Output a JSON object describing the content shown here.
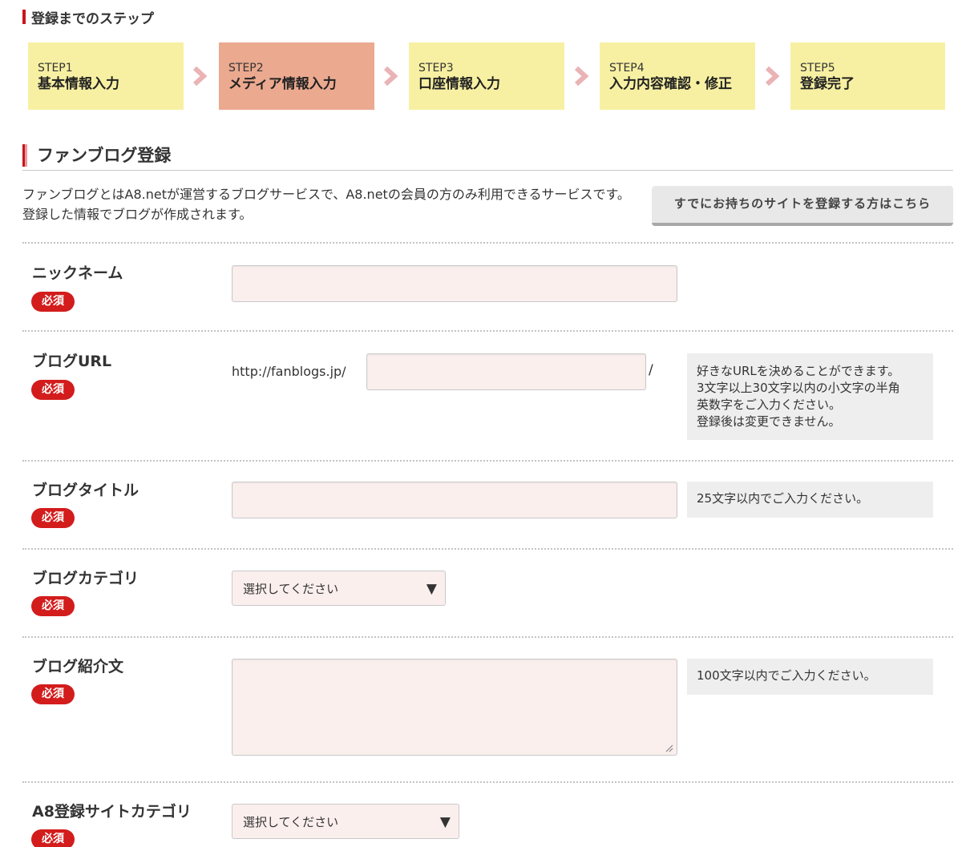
{
  "steps_heading": "登録までのステップ",
  "steps": [
    {
      "num": "STEP1",
      "name": "基本情報入力",
      "active": false
    },
    {
      "num": "STEP2",
      "name": "メディア情報入力",
      "active": true
    },
    {
      "num": "STEP3",
      "name": "口座情報入力",
      "active": false
    },
    {
      "num": "STEP4",
      "name": "入力内容確認・修正",
      "active": false
    },
    {
      "num": "STEP5",
      "name": "登録完了",
      "active": false
    }
  ],
  "section": {
    "title": "ファンブログ登録",
    "intro": "ファンブログとはA8.netが運営するブログサービスで、A8.netの会員の方のみ利用できるサービスです。登録した情報でブログが作成されます。",
    "existing_button": "すでにお持ちのサイトを登録する方はこちら"
  },
  "required_badge": "必須",
  "form": {
    "nickname": {
      "label": "ニックネーム",
      "value": ""
    },
    "blog_url": {
      "label": "ブログURL",
      "prefix": "http://fanblogs.jp/",
      "suffix": "/",
      "value": "",
      "note": [
        "好きなURLを決めることができます。",
        "3文字以上30文字以内の小文字の半角",
        "英数字をご入力ください。",
        "登録後は変更できません。"
      ]
    },
    "blog_title": {
      "label": "ブログタイトル",
      "value": "",
      "note": "25文字以内でご入力ください。"
    },
    "blog_category": {
      "label": "ブログカテゴリ",
      "selected": "選択してください"
    },
    "blog_intro": {
      "label": "ブログ紹介文",
      "value": "",
      "note": "100文字以内でご入力ください。"
    },
    "a8_site_category": {
      "label": "A8登録サイトカテゴリ",
      "selected": "選択してください"
    }
  },
  "colors": {
    "accent_red": "#c8161d",
    "step_bg": "#f7f0a2",
    "step_active_bg": "#eba98f",
    "input_bg": "#fbefee",
    "note_bg": "#eeeeee"
  }
}
